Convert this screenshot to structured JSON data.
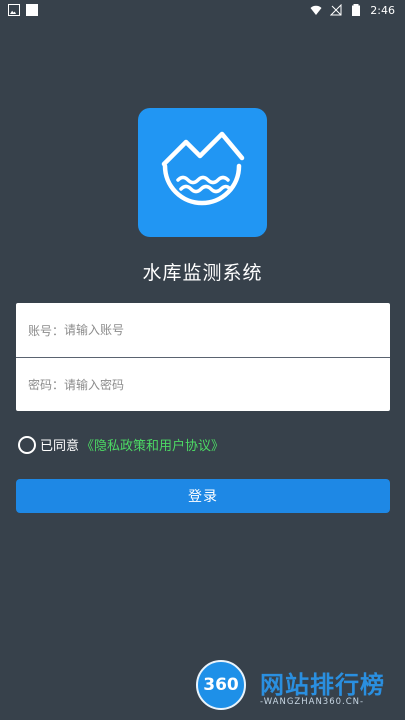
{
  "statusbar": {
    "time": "2:46"
  },
  "app": {
    "title": "水库监测系统"
  },
  "form": {
    "account_label": "账号：",
    "account_placeholder": "请输入账号",
    "password_label": "密码：",
    "password_placeholder": "请输入密码"
  },
  "agreement": {
    "text": "已同意",
    "link": "《隐私政策和用户协议》"
  },
  "login": {
    "label": "登录"
  },
  "watermark": {
    "number": "360",
    "title": "网站排行榜",
    "subtitle": "-WANGZHAN360.CN-"
  }
}
